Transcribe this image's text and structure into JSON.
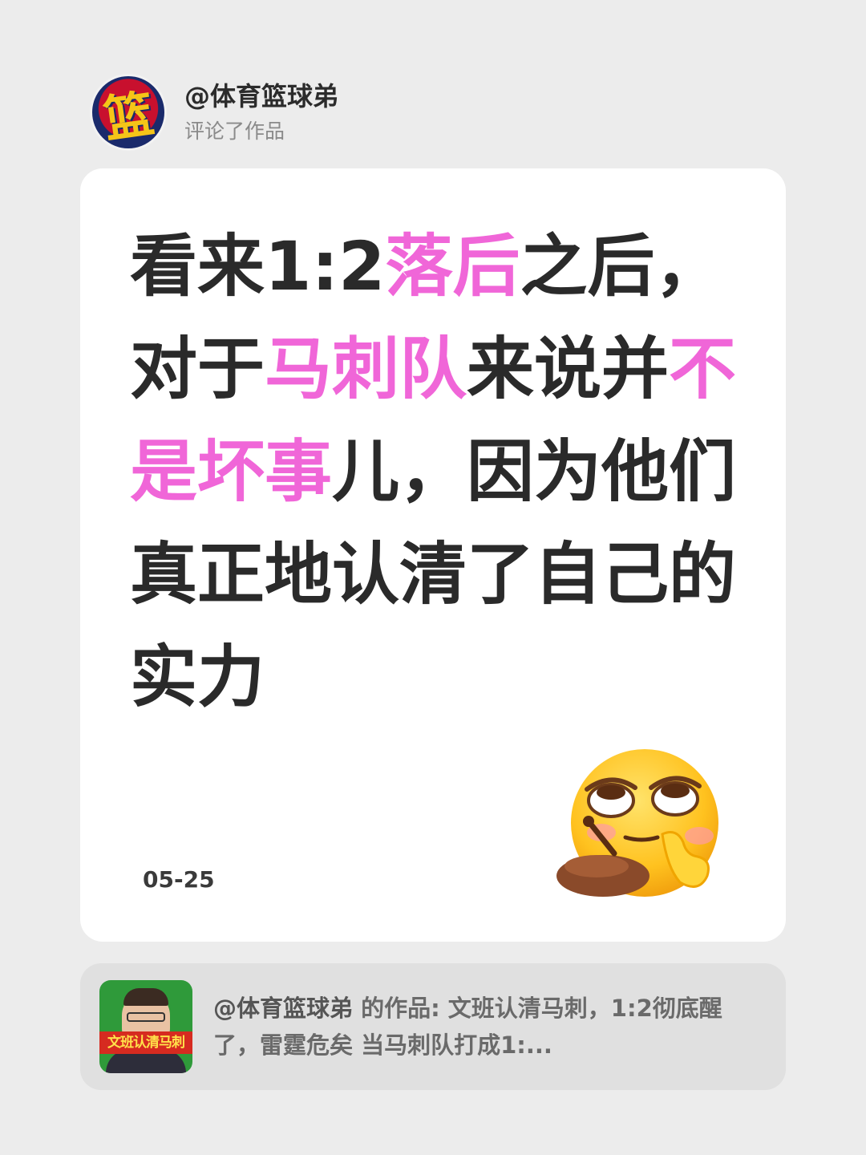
{
  "header": {
    "avatar_glyph": "篮",
    "username": "@体育篮球弟",
    "action": "评论了作品"
  },
  "comment": {
    "segments": [
      {
        "text": "看来1:2",
        "highlight": false
      },
      {
        "text": "落后",
        "highlight": true
      },
      {
        "text": "之后，对于",
        "highlight": false
      },
      {
        "text": "马刺队",
        "highlight": true
      },
      {
        "text": "来说并",
        "highlight": false
      },
      {
        "text": "不是坏事",
        "highlight": true
      },
      {
        "text": "儿，因为他们真正地认清了自己的实力",
        "highlight": false
      }
    ],
    "highlight_color": "#f066d8",
    "text_color": "#2a2a2a",
    "emoji": "smirk-eye-roll-emoji",
    "date": "05-25"
  },
  "source": {
    "thumbnail_caption": "文班认清马刺",
    "author": "@体育篮球弟",
    "text": " 的作品: 文班认清马刺，1:2彻底醒了，雷霆危矣 当马刺队打成1:..."
  }
}
